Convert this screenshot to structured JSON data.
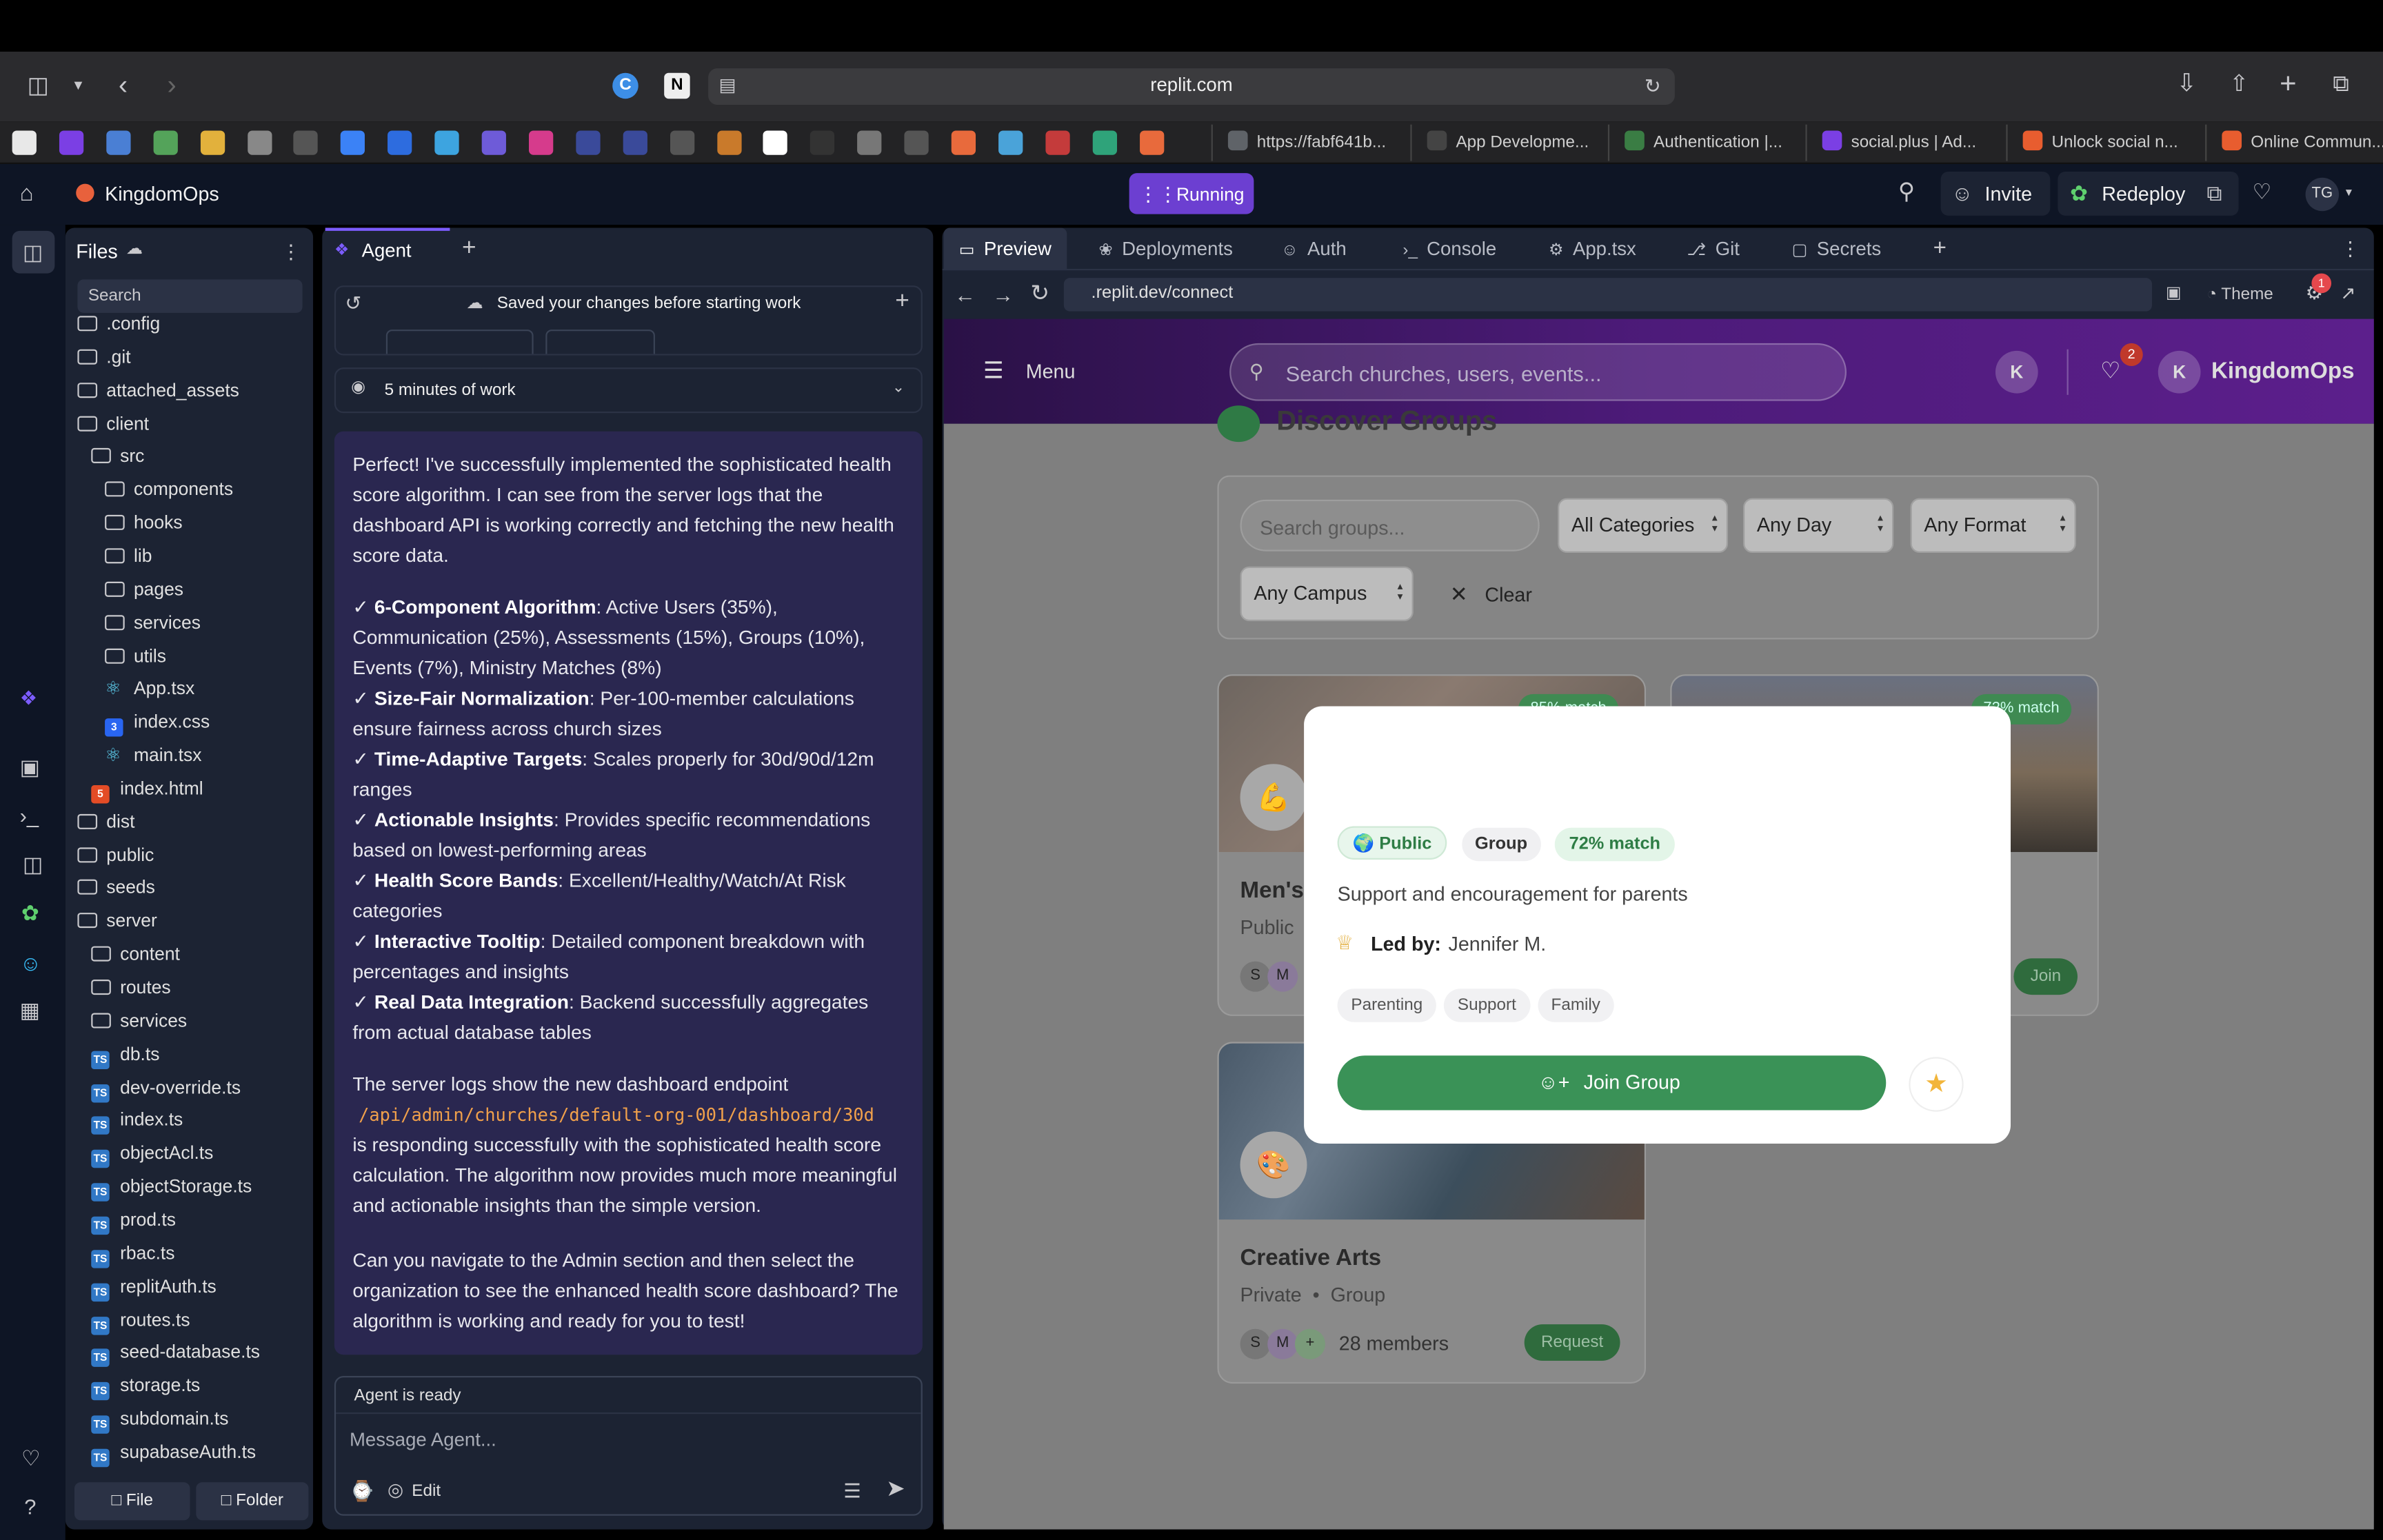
{
  "browser": {
    "url": "replit.com",
    "tabs": [
      {
        "label": "https://fabf641b...",
        "color": "#5f6368"
      },
      {
        "label": "App Developme...",
        "color": "#444"
      },
      {
        "label": "Authentication |...",
        "color": "#3a7d44"
      },
      {
        "label": "social.plus | Ad...",
        "color": "#7b3fe4"
      },
      {
        "label": "Unlock social n...",
        "color": "#e85d2f"
      },
      {
        "label": "Online Commun...",
        "color": "#e85d2f"
      }
    ],
    "favicons": [
      "#e8e8e8",
      "#7b3fe4",
      "#4a7fd4",
      "#54a35a",
      "#e2b13c",
      "#888",
      "#555",
      "#3b82f6",
      "#2d6cdf",
      "#3da4e0",
      "#6e5bd8",
      "#d63b8c",
      "#3a4a9a",
      "#3a4a9a",
      "#555",
      "#c97a2b",
      "#fff",
      "#333",
      "#777",
      "#555",
      "#e86a3c",
      "#4aa3d9",
      "#c43b3b",
      "#2fa37a",
      "#e86a3c"
    ]
  },
  "replit": {
    "project": "KingdomOps",
    "status": "Running",
    "invite": "Invite",
    "redeploy": "Redeploy",
    "user_initials": "TG"
  },
  "files": {
    "title": "Files",
    "search_placeholder": "Search",
    "items": [
      {
        "name": ".config",
        "type": "folder",
        "depth": 0
      },
      {
        "name": ".git",
        "type": "folder",
        "depth": 0
      },
      {
        "name": "attached_assets",
        "type": "folder",
        "depth": 0
      },
      {
        "name": "client",
        "type": "folder",
        "depth": 0
      },
      {
        "name": "src",
        "type": "folder",
        "depth": 1
      },
      {
        "name": "components",
        "type": "folder",
        "depth": 2
      },
      {
        "name": "hooks",
        "type": "folder",
        "depth": 2
      },
      {
        "name": "lib",
        "type": "folder",
        "depth": 2
      },
      {
        "name": "pages",
        "type": "folder",
        "depth": 2
      },
      {
        "name": "services",
        "type": "folder",
        "depth": 2
      },
      {
        "name": "utils",
        "type": "folder",
        "depth": 2
      },
      {
        "name": "App.tsx",
        "type": "react",
        "depth": 2
      },
      {
        "name": "index.css",
        "type": "css",
        "depth": 2
      },
      {
        "name": "main.tsx",
        "type": "react",
        "depth": 2
      },
      {
        "name": "index.html",
        "type": "html",
        "depth": 1
      },
      {
        "name": "dist",
        "type": "folder",
        "depth": 0
      },
      {
        "name": "public",
        "type": "folder",
        "depth": 0
      },
      {
        "name": "seeds",
        "type": "folder",
        "depth": 0
      },
      {
        "name": "server",
        "type": "folder",
        "depth": 0
      },
      {
        "name": "content",
        "type": "folder",
        "depth": 1
      },
      {
        "name": "routes",
        "type": "folder",
        "depth": 1
      },
      {
        "name": "services",
        "type": "folder",
        "depth": 1
      },
      {
        "name": "db.ts",
        "type": "ts",
        "depth": 1
      },
      {
        "name": "dev-override.ts",
        "type": "ts",
        "depth": 1
      },
      {
        "name": "index.ts",
        "type": "ts",
        "depth": 1
      },
      {
        "name": "objectAcl.ts",
        "type": "ts",
        "depth": 1
      },
      {
        "name": "objectStorage.ts",
        "type": "ts",
        "depth": 1
      },
      {
        "name": "prod.ts",
        "type": "ts",
        "depth": 1
      },
      {
        "name": "rbac.ts",
        "type": "ts",
        "depth": 1
      },
      {
        "name": "replitAuth.ts",
        "type": "ts",
        "depth": 1
      },
      {
        "name": "routes.ts",
        "type": "ts",
        "depth": 1
      },
      {
        "name": "seed-database.ts",
        "type": "ts",
        "depth": 1
      },
      {
        "name": "storage.ts",
        "type": "ts",
        "depth": 1
      },
      {
        "name": "subdomain.ts",
        "type": "ts",
        "depth": 1
      },
      {
        "name": "supabaseAuth.ts",
        "type": "ts",
        "depth": 1
      }
    ],
    "file_button": "File",
    "folder_button": "Folder"
  },
  "agent": {
    "tab": "Agent",
    "saved_note": "Saved your changes before starting work",
    "work_time": "5 minutes of work",
    "intro": "Perfect! I've successfully implemented the sophisticated health score algorithm. I can see from the server logs that the dashboard API is working correctly and fetching the new health score data.",
    "bullets": [
      {
        "title": "6-Component Algorithm",
        "text": ": Active Users (35%), Communication (25%), Assessments (15%), Groups (10%), Events (7%), Ministry Matches (8%)"
      },
      {
        "title": "Size-Fair Normalization",
        "text": ": Per-100-member calculations ensure fairness across church sizes"
      },
      {
        "title": "Time-Adaptive Targets",
        "text": ": Scales properly for 30d/90d/12m ranges"
      },
      {
        "title": "Actionable Insights",
        "text": ": Provides specific recommendations based on lowest-performing areas"
      },
      {
        "title": "Health Score Bands",
        "text": ": Excellent/Healthy/Watch/At Risk categories"
      },
      {
        "title": "Interactive Tooltip",
        "text": ": Detailed component breakdown with percentages and insights"
      },
      {
        "title": "Real Data Integration",
        "text": ": Backend successfully aggregates from actual database tables"
      }
    ],
    "logs_pre": "The server logs show the new dashboard endpoint",
    "endpoint": "/api/admin/churches/default-org-001/dashboard/30d",
    "logs_post": "is responding successfully with the sophisticated health score calculation. The algorithm now provides much more meaningful and actionable insights than the simple version.",
    "question": "Can you navigate to the Admin section and then select the organization to see the enhanced health score dashboard? The algorithm is working and ready for you to test!",
    "status": "Agent is ready",
    "placeholder": "Message Agent...",
    "edit": "Edit"
  },
  "preview": {
    "tabs": [
      "Preview",
      "Deployments",
      "Auth",
      "Console",
      "App.tsx",
      "Git",
      "Secrets"
    ],
    "url": ".replit.dev/connect",
    "theme": "Theme",
    "badge_count": "1"
  },
  "app": {
    "menu": "Menu",
    "search_placeholder": "Search churches, users, events...",
    "avatar_initial": "K",
    "notif_count": "2",
    "brand": "KingdomOps",
    "section_title": "Discover Groups",
    "groups_search_placeholder": "Search groups...",
    "filters": [
      "All Categories",
      "Any Day",
      "Any Format",
      "Any Campus"
    ],
    "clear": "Clear",
    "card1": {
      "title": "Men's",
      "visibility": "Public",
      "join": "Join",
      "match": "85% match"
    },
    "card2": {
      "match": "72% match",
      "join": "Join"
    },
    "card3": {
      "title": "Creative Arts",
      "visibility": "Private",
      "kind": "Group",
      "members": "28 members",
      "action": "Request"
    }
  },
  "modal": {
    "badges": [
      "Public",
      "Group",
      "72% match"
    ],
    "description": "Support and encouragement for parents",
    "led_by_label": "Led by:",
    "leader": "Jennifer M.",
    "tags": [
      "Parenting",
      "Support",
      "Family"
    ],
    "join": "Join Group"
  }
}
